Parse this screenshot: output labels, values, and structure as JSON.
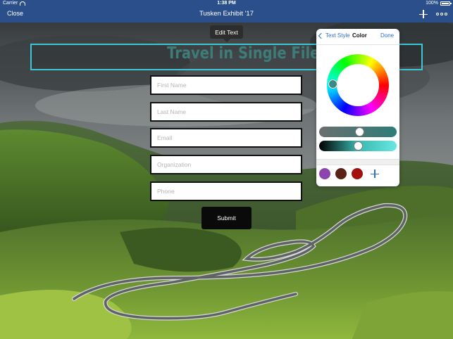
{
  "status_bar": {
    "carrier": "Carrier",
    "time": "1:38 PM",
    "battery": "100%"
  },
  "nav_bar": {
    "close_label": "Close",
    "title": "Tusken Exhibit '17",
    "add_icon": "plus-icon",
    "more_icon": "more-icon"
  },
  "tooltip": {
    "label": "Edit Text"
  },
  "headline": {
    "text": "Travel in Single File",
    "color": "#3d7c78",
    "selection_border_color": "#3ec6d6"
  },
  "form": {
    "fields": [
      {
        "placeholder": "First Name"
      },
      {
        "placeholder": "Last Name"
      },
      {
        "placeholder": "Email"
      },
      {
        "placeholder": "Organization"
      },
      {
        "placeholder": "Phone"
      }
    ],
    "submit_label": "Submit"
  },
  "color_popover": {
    "back_label": "Text Style",
    "title": "Color",
    "done_label": "Done",
    "saturation_level": 0.53,
    "brightness_level": 0.5,
    "swatches": [
      "#8e44ad",
      "#5a2116",
      "#a30f0f"
    ],
    "accent": "#2f6ed6"
  }
}
